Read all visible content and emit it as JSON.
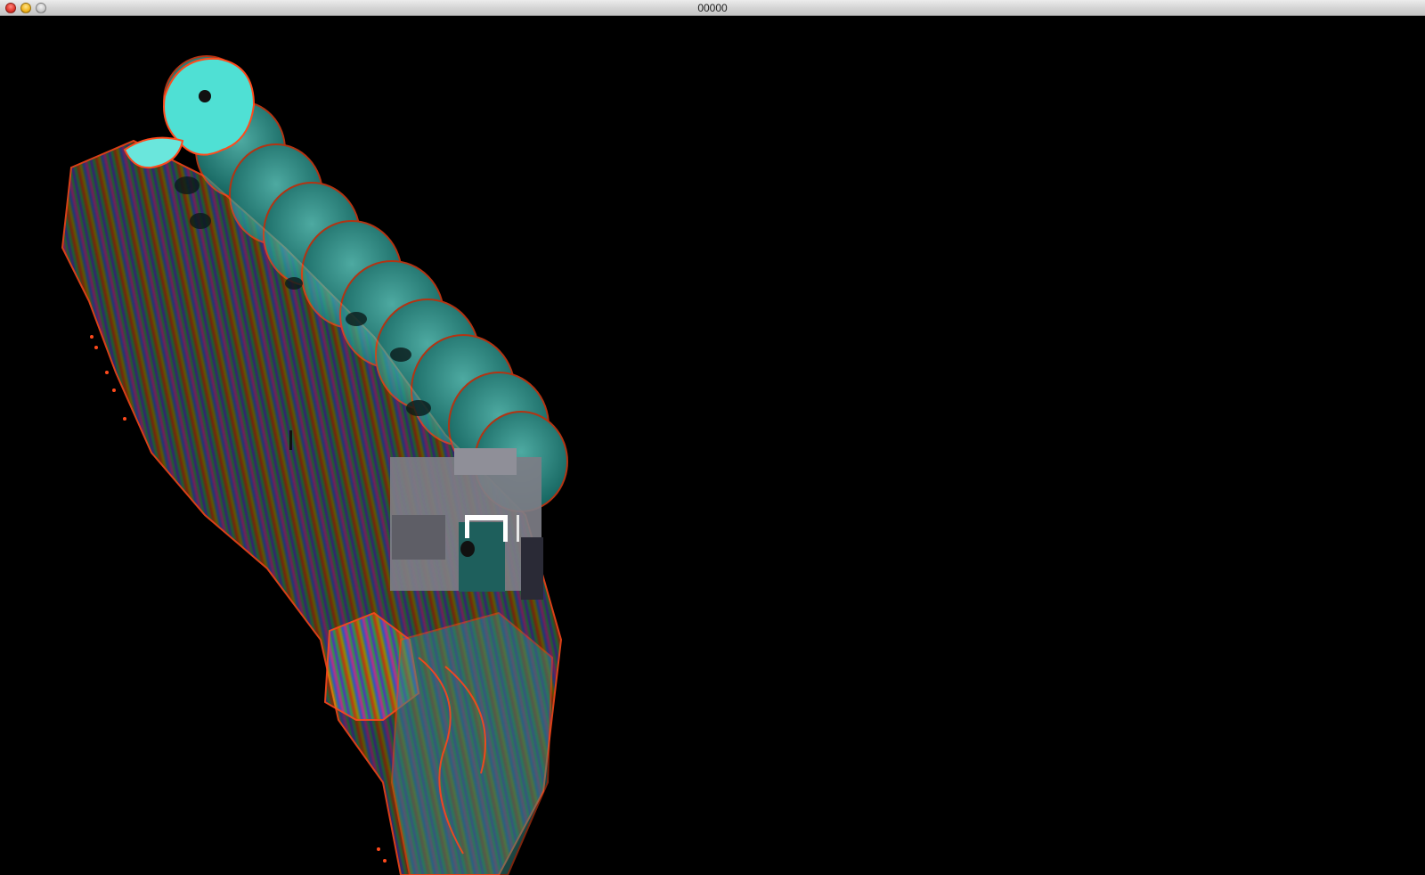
{
  "window": {
    "title": "00000"
  },
  "canvas": {
    "background": "#000000",
    "palette": {
      "cyan": "#3fd6cc",
      "edge": "#ff4a1c",
      "gray": "#8a8a90"
    }
  }
}
